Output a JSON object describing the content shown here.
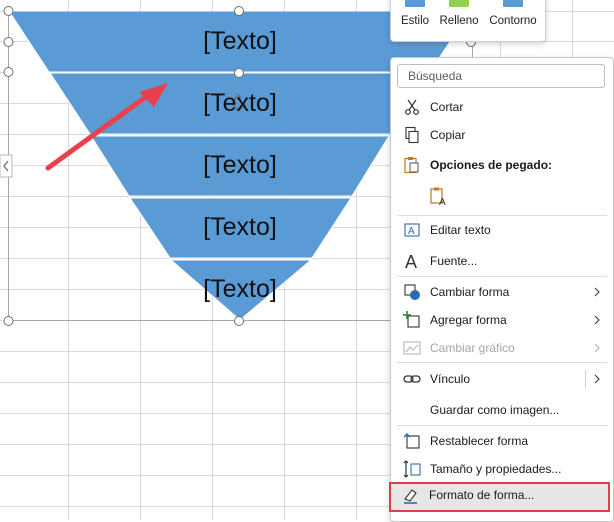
{
  "shape": {
    "fill_color": "#5b9bd5",
    "text_rows": [
      "[Texto]",
      "[Texto]",
      "[Texto]",
      "[Texto]",
      "[Texto]"
    ]
  },
  "annotation": {
    "arrow_color": "#e8414c",
    "highlight_color": "#d9424a"
  },
  "mini_toolbar": {
    "buttons": [
      {
        "label": "Estilo",
        "color": "#5b9bd5"
      },
      {
        "label": "Relleno",
        "color": "#92d050"
      },
      {
        "label": "Contorno",
        "color": "#5b9bd5"
      }
    ]
  },
  "context_menu": {
    "search_placeholder": "Búsqueda",
    "items": {
      "cut": "Cortar",
      "copy": "Copiar",
      "paste_options": "Opciones de pegado:",
      "edit_text": "Editar texto",
      "font": "Fuente...",
      "change_shape": "Cambiar forma",
      "add_shape": "Agregar forma",
      "change_graphic": "Cambiar gráfico",
      "link": "Vínculo",
      "save_as_image": "Guardar como imagen...",
      "reset_shape": "Restablecer forma",
      "size_properties": "Tamaño y propiedades...",
      "format_shape": "Formato de forma..."
    }
  }
}
